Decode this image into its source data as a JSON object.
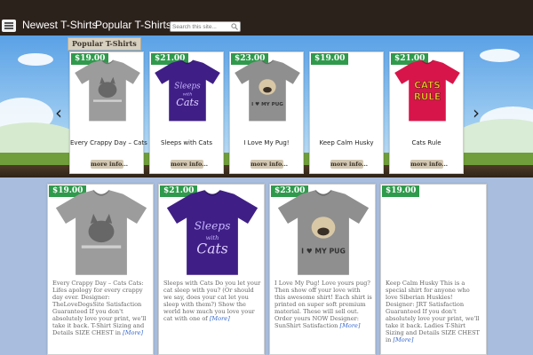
{
  "nav": {
    "links": [
      "Newest T-Shirts",
      "Popular T-Shirts"
    ],
    "search_placeholder": "Search this site..."
  },
  "slider": {
    "title": "Popular T-Shirts",
    "products": [
      {
        "price": "$19.00",
        "name": "Every Crappy Day – Cats",
        "more": "more info...",
        "shirt_color": "#9c9c9c",
        "print": "cat"
      },
      {
        "price": "$21.00",
        "name": "Sleeps with Cats",
        "more": "more info...",
        "shirt_color": "#3f1f86",
        "print": "sleeps"
      },
      {
        "price": "$23.00",
        "name": "I Love My Pug!",
        "more": "more info...",
        "shirt_color": "#8f8f8f",
        "print": "pug"
      },
      {
        "price": "$19.00",
        "name": "Keep Calm Husky",
        "more": "more info...",
        "shirt_color": "",
        "print": "none"
      },
      {
        "price": "$21.00",
        "name": "Cats Rule",
        "more": "more info...",
        "shirt_color": "#d8154a",
        "print": "catsrule"
      }
    ]
  },
  "grid": {
    "products": [
      {
        "price": "$19.00",
        "description": "Every Crappy Day – Cats Cats: Lifes apology for every crappy day ever. Designer: TheLoveDogsSite Satisfaction Guaranteed If you don't absolutely love your print, we'll take it back. T-Shirt Sizing and Details SIZE CHEST in",
        "more": "[More]",
        "shirt_color": "#9c9c9c",
        "print": "cat"
      },
      {
        "price": "$21.00",
        "description": "Sleeps with Cats Do you let your cat sleep with you? (Or should we say, does your cat let you sleep with them?) Show the world how much you love your cat with one of",
        "more": "[More]",
        "shirt_color": "#3f1f86",
        "print": "sleeps"
      },
      {
        "price": "$23.00",
        "description": "I Love My Pug! Love yours pug? Then show off your love with this awesome shirt! Each shirt is printed on super soft premium material. These will sell out. Order yours NOW Designer: SunShirt Satisfaction",
        "more": "[More]",
        "shirt_color": "#8f8f8f",
        "print": "pug"
      },
      {
        "price": "$19.00",
        "description": "Keep Calm Husky This is a special shirt for anyone who love Siberian Huskies! Designer: JRT Satisfaction Guaranteed If you don't absolutely love your print, we'll take it back. Ladies T-Shirt Sizing and Details SIZE CHEST in",
        "more": "[More]",
        "shirt_color": "",
        "print": "none"
      }
    ]
  }
}
